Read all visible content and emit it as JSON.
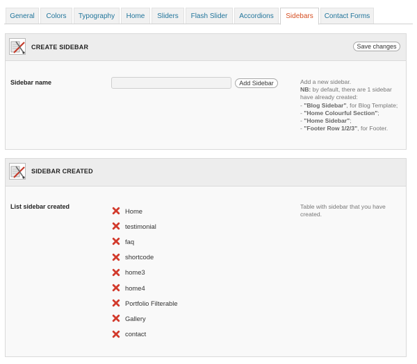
{
  "tabs": [
    {
      "label": "General",
      "active": false
    },
    {
      "label": "Colors",
      "active": false
    },
    {
      "label": "Typography",
      "active": false
    },
    {
      "label": "Home",
      "active": false
    },
    {
      "label": "Sliders",
      "active": false
    },
    {
      "label": "Flash Slider",
      "active": false
    },
    {
      "label": "Accordions",
      "active": false
    },
    {
      "label": "Sidebars",
      "active": true
    },
    {
      "label": "Contact Forms",
      "active": false
    }
  ],
  "create_panel": {
    "title": "CREATE SIDEBAR",
    "save_label": "Save changes",
    "field_label": "Sidebar name",
    "input_value": "",
    "add_label": "Add Sidebar",
    "help": {
      "line1": "Add a new sidebar.",
      "nb_label": "NB:",
      "nb_text": " by default, there are 1 sidebar",
      "line3": "have already created:",
      "item1_prefix": "- ",
      "item1_name": "\"Blog Sidebar\"",
      "item1_suffix": ", for Blog Template;",
      "item2_prefix": "- ",
      "item2_name": "\"Home Colourful Section\"",
      "item2_suffix": ";",
      "item3_prefix": "- ",
      "item3_name": "\"Home Sidebar\"",
      "item3_suffix": ";",
      "item4_prefix": "- ",
      "item4_name": "\"Footer Row 1/2/3\"",
      "item4_suffix": ", for Footer."
    }
  },
  "created_panel": {
    "title": "SIDEBAR CREATED",
    "field_label": "List sidebar created",
    "help_line1": "Table with sidebar that you have",
    "help_line2": "created.",
    "sidebars": [
      "Home",
      "testimonial",
      "faq",
      "shortcode",
      "home3",
      "home4",
      "Portfolio Filterable",
      "Gallery",
      "contact"
    ]
  },
  "colors": {
    "tab_link": "#21759b",
    "tab_active": "#d54e21",
    "delete_icon": "#d23a2c"
  },
  "icons": {
    "panel_icon": "edit-tools-icon",
    "delete_icon": "red-x-delete-icon"
  }
}
